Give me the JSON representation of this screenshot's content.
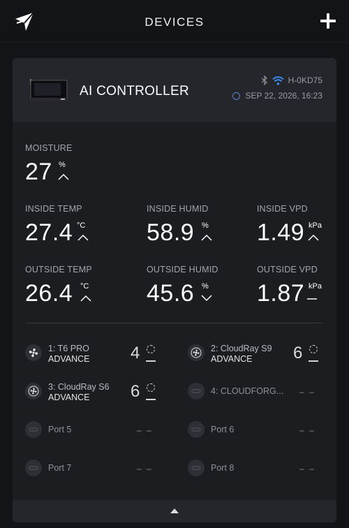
{
  "header": {
    "title": "DEVICES",
    "logo_icon": "logo-icon",
    "add_icon": "plus-icon"
  },
  "device": {
    "name": "AI CONTROLLER",
    "id": "H-0KD75",
    "datetime": "SEP 22, 2026, 16:23",
    "status_icons": [
      "bluetooth-icon",
      "wifi-icon"
    ],
    "accent": "#3b8cf0"
  },
  "moisture": {
    "label": "MOISTURE",
    "value": "27",
    "unit": "%",
    "trend": "up"
  },
  "inside": {
    "temp": {
      "label": "INSIDE TEMP",
      "value": "27.4",
      "unit": "°C",
      "trend": "up"
    },
    "humid": {
      "label": "INSIDE HUMID",
      "value": "58.9",
      "unit": "%",
      "trend": "up"
    },
    "vpd": {
      "label": "INSIDE VPD",
      "value": "1.49",
      "unit": "kPa",
      "trend": "up"
    }
  },
  "outside": {
    "temp": {
      "label": "OUTSIDE TEMP",
      "value": "26.4",
      "unit": "°C",
      "trend": "up"
    },
    "humid": {
      "label": "OUTSIDE HUMID",
      "value": "45.6",
      "unit": "%",
      "trend": "down"
    },
    "vpd": {
      "label": "OUTSIDE VPD",
      "value": "1.87",
      "unit": "kPa",
      "trend": "flat"
    }
  },
  "ports": [
    {
      "name": "1: T6 PRO",
      "mode": "ADVANCE",
      "level": "4",
      "icon": "fan-icon"
    },
    {
      "name": "2: CloudRay S9",
      "mode": "ADVANCE",
      "level": "6",
      "icon": "fan-icon"
    },
    {
      "name": "3: CloudRay S6",
      "mode": "ADVANCE",
      "level": "6",
      "icon": "fan-icon"
    },
    {
      "name": "4: CLOUDFORG...",
      "dash": "– –",
      "icon": "plug-icon"
    },
    {
      "name": "Port 5",
      "dash": "– –",
      "icon": "plug-icon"
    },
    {
      "name": "Port 6",
      "dash": "– –",
      "icon": "plug-icon"
    },
    {
      "name": "Port 7",
      "dash": "– –",
      "icon": "plug-icon"
    },
    {
      "name": "Port 8",
      "dash": "– –",
      "icon": "plug-icon"
    }
  ]
}
